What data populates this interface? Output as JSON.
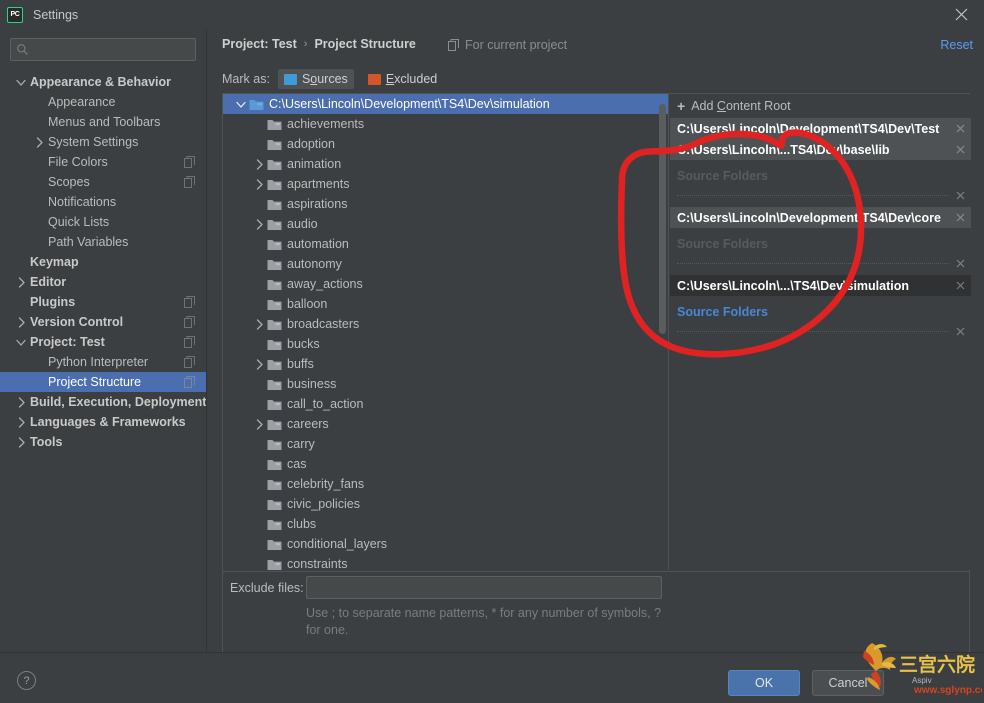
{
  "window": {
    "title": "Settings",
    "app_icon": "pycharm-pc-icon",
    "close_icon": "close-icon"
  },
  "search": {
    "placeholder": "",
    "value": "",
    "icon": "search-icon"
  },
  "sidebar": {
    "items": [
      {
        "label": "Appearance & Behavior",
        "level": 1,
        "bold": true,
        "arrow": "down",
        "copy": false
      },
      {
        "label": "Appearance",
        "level": 2,
        "bold": false,
        "arrow": "none",
        "copy": false
      },
      {
        "label": "Menus and Toolbars",
        "level": 2,
        "bold": false,
        "arrow": "none",
        "copy": false
      },
      {
        "label": "System Settings",
        "level": 2,
        "bold": false,
        "arrow": "right",
        "copy": false
      },
      {
        "label": "File Colors",
        "level": 2,
        "bold": false,
        "arrow": "none",
        "copy": true
      },
      {
        "label": "Scopes",
        "level": 2,
        "bold": false,
        "arrow": "none",
        "copy": true
      },
      {
        "label": "Notifications",
        "level": 2,
        "bold": false,
        "arrow": "none",
        "copy": false
      },
      {
        "label": "Quick Lists",
        "level": 2,
        "bold": false,
        "arrow": "none",
        "copy": false
      },
      {
        "label": "Path Variables",
        "level": 2,
        "bold": false,
        "arrow": "none",
        "copy": false
      },
      {
        "label": "Keymap",
        "level": 1,
        "bold": true,
        "arrow": "none",
        "copy": false
      },
      {
        "label": "Editor",
        "level": 1,
        "bold": true,
        "arrow": "right",
        "copy": false
      },
      {
        "label": "Plugins",
        "level": 1,
        "bold": true,
        "arrow": "none",
        "copy": true
      },
      {
        "label": "Version Control",
        "level": 1,
        "bold": true,
        "arrow": "right",
        "copy": true
      },
      {
        "label": "Project: Test",
        "level": 1,
        "bold": true,
        "arrow": "down",
        "copy": true
      },
      {
        "label": "Python Interpreter",
        "level": 2,
        "bold": false,
        "arrow": "none",
        "copy": true
      },
      {
        "label": "Project Structure",
        "level": 2,
        "bold": false,
        "arrow": "none",
        "copy": true,
        "selected": true
      },
      {
        "label": "Build, Execution, Deployment",
        "level": 1,
        "bold": true,
        "arrow": "right",
        "copy": false
      },
      {
        "label": "Languages & Frameworks",
        "level": 1,
        "bold": true,
        "arrow": "right",
        "copy": false
      },
      {
        "label": "Tools",
        "level": 1,
        "bold": true,
        "arrow": "right",
        "copy": false
      }
    ]
  },
  "header": {
    "crumb_project": "Project: Test",
    "crumb_separator": "›",
    "crumb_page": "Project Structure",
    "for_current_project": "For current project",
    "for_current_icon": "copy-icon",
    "reset": "Reset"
  },
  "mark_as": {
    "label": "Mark as:",
    "sources": {
      "text_prefix": "S",
      "text_underlined": "o",
      "text_suffix": "urces",
      "full": "Sources",
      "color": "#3f9ad8"
    },
    "excluded": {
      "text_prefix": "",
      "text_underlined": "E",
      "text_suffix": "xcluded",
      "full": "Excluded",
      "color": "#d2562a"
    }
  },
  "folder_tree": {
    "items": [
      {
        "label": "C:\\Users\\Lincoln\\Development\\TS4\\Dev\\simulation",
        "indent": 0,
        "arrow": "down",
        "selected": true,
        "root": true
      },
      {
        "label": "achievements",
        "indent": 1,
        "arrow": "none",
        "selected": false
      },
      {
        "label": "adoption",
        "indent": 1,
        "arrow": "none",
        "selected": false
      },
      {
        "label": "animation",
        "indent": 1,
        "arrow": "right",
        "selected": false
      },
      {
        "label": "apartments",
        "indent": 1,
        "arrow": "right",
        "selected": false
      },
      {
        "label": "aspirations",
        "indent": 1,
        "arrow": "none",
        "selected": false
      },
      {
        "label": "audio",
        "indent": 1,
        "arrow": "right",
        "selected": false
      },
      {
        "label": "automation",
        "indent": 1,
        "arrow": "none",
        "selected": false
      },
      {
        "label": "autonomy",
        "indent": 1,
        "arrow": "none",
        "selected": false
      },
      {
        "label": "away_actions",
        "indent": 1,
        "arrow": "none",
        "selected": false
      },
      {
        "label": "balloon",
        "indent": 1,
        "arrow": "none",
        "selected": false
      },
      {
        "label": "broadcasters",
        "indent": 1,
        "arrow": "right",
        "selected": false
      },
      {
        "label": "bucks",
        "indent": 1,
        "arrow": "none",
        "selected": false
      },
      {
        "label": "buffs",
        "indent": 1,
        "arrow": "right",
        "selected": false
      },
      {
        "label": "business",
        "indent": 1,
        "arrow": "none",
        "selected": false
      },
      {
        "label": "call_to_action",
        "indent": 1,
        "arrow": "none",
        "selected": false
      },
      {
        "label": "careers",
        "indent": 1,
        "arrow": "right",
        "selected": false
      },
      {
        "label": "carry",
        "indent": 1,
        "arrow": "none",
        "selected": false
      },
      {
        "label": "cas",
        "indent": 1,
        "arrow": "none",
        "selected": false
      },
      {
        "label": "celebrity_fans",
        "indent": 1,
        "arrow": "none",
        "selected": false
      },
      {
        "label": "civic_policies",
        "indent": 1,
        "arrow": "none",
        "selected": false
      },
      {
        "label": "clubs",
        "indent": 1,
        "arrow": "none",
        "selected": false
      },
      {
        "label": "conditional_layers",
        "indent": 1,
        "arrow": "none",
        "selected": false
      },
      {
        "label": "constraints",
        "indent": 1,
        "arrow": "none",
        "selected": false
      }
    ]
  },
  "content_roots": {
    "add_button": "Add Content Root",
    "add_underlined_char": "C",
    "source_folders_label": "Source Folders",
    "roots": [
      {
        "path": "C:\\Users\\Lincoln\\Development\\TS4\\Dev\\Test",
        "style": "light",
        "show_sources": false,
        "highlight": false
      },
      {
        "path": "C:\\Users\\Lincoln\\...TS4\\Dev\\base\\lib",
        "style": "light",
        "show_sources": true,
        "highlight": false
      },
      {
        "path": "C:\\Users\\Lincoln\\Development\\TS4\\Dev\\core",
        "style": "light",
        "show_sources": true,
        "highlight": false
      },
      {
        "path": "C:\\Users\\Lincoln\\...\\TS4\\Dev\\simulation",
        "style": "dark",
        "show_sources": true,
        "highlight": true
      }
    ]
  },
  "exclude": {
    "label": "Exclude files:",
    "value": "",
    "placeholder": "",
    "hint": "Use ; to separate name patterns, * for any number of symbols, ? for one."
  },
  "footer": {
    "help": "?",
    "ok": "OK",
    "cancel": "Cancel"
  },
  "watermark": {
    "chinese": "三宫六院",
    "site": "www.sglynp.com",
    "small": "Aspiv"
  },
  "colors": {
    "window_bg": "#3c3f41",
    "selection_blue": "#4b6eaf",
    "link_blue": "#589df6",
    "annotation_red": "#e02222",
    "accent_green": "#21d789",
    "sources_blue": "#3f9ad8",
    "excluded_orange": "#d2562a"
  }
}
